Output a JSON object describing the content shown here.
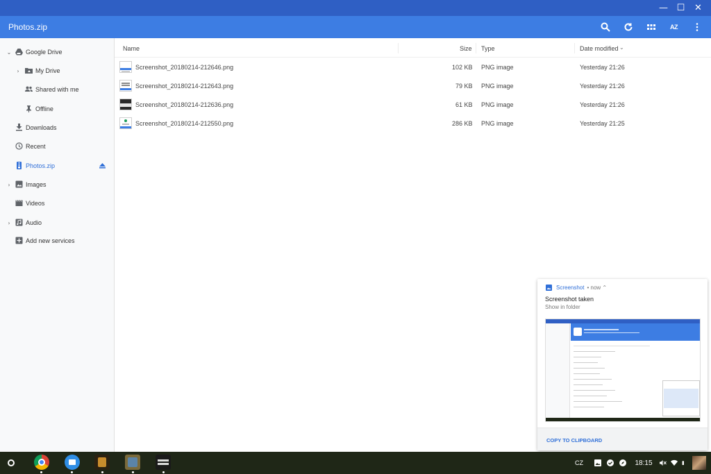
{
  "window": {
    "controls": [
      "minimize-icon",
      "maximize-icon",
      "close-icon"
    ]
  },
  "appbar": {
    "title": "Photos.zip",
    "actions": [
      "search-icon",
      "refresh-icon",
      "grid-view-icon",
      "sort-az-icon",
      "more-vertical-icon"
    ],
    "sort_label": "AZ"
  },
  "sidebar": {
    "items": [
      {
        "label": "Google Drive",
        "icon": "google-drive-icon",
        "expanded": true
      },
      {
        "label": "My Drive",
        "icon": "my-drive-icon"
      },
      {
        "label": "Shared with me",
        "icon": "shared-people-icon"
      },
      {
        "label": "Offline",
        "icon": "pin-icon"
      },
      {
        "label": "Downloads",
        "icon": "download-icon"
      },
      {
        "label": "Recent",
        "icon": "clock-icon"
      },
      {
        "label": "Photos.zip",
        "icon": "zip-icon",
        "active": true
      },
      {
        "label": "Images",
        "icon": "image-icon"
      },
      {
        "label": "Videos",
        "icon": "video-icon"
      },
      {
        "label": "Audio",
        "icon": "audio-icon"
      },
      {
        "label": "Add new services",
        "icon": "add-box-icon"
      }
    ]
  },
  "table": {
    "columns": {
      "name": "Name",
      "size": "Size",
      "type": "Type",
      "date": "Date modified"
    },
    "rows": [
      {
        "name": "Screenshot_20180214-212646.png",
        "size": "102 KB",
        "type": "PNG image",
        "date": "Yesterday 21:26"
      },
      {
        "name": "Screenshot_20180214-212643.png",
        "size": "79 KB",
        "type": "PNG image",
        "date": "Yesterday 21:26"
      },
      {
        "name": "Screenshot_20180214-212636.png",
        "size": "61 KB",
        "type": "PNG image",
        "date": "Yesterday 21:26"
      },
      {
        "name": "Screenshot_20180214-212550.png",
        "size": "286 KB",
        "type": "PNG image",
        "date": "Yesterday 21:25"
      }
    ]
  },
  "notification": {
    "app": "Screenshot",
    "meta": "• now ⌃",
    "title": "Screenshot taken",
    "message": "Show in folder",
    "action": "COPY TO CLIPBOARD"
  },
  "shelf": {
    "apps": [
      "chrome-icon",
      "files-icon",
      "app-1-icon",
      "app-2-icon",
      "war-of-mine-icon"
    ],
    "keyboard_layout": "CZ",
    "time": "18:15"
  },
  "colors": {
    "titlebar": "#2f5fc4",
    "appbar": "#3d7de3",
    "accent": "#2f6fd8",
    "shelf": "#1f2717"
  }
}
